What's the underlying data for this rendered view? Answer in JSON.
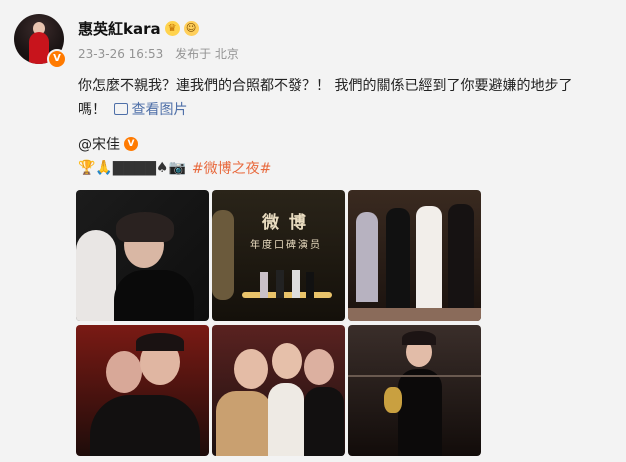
{
  "post": {
    "username": "惠英紅kara",
    "timestamp": "23-3-26 16:53",
    "posted_from": "发布于 北京",
    "text_line1": "你怎麼不親我？連我們的合照都不發？！ 我們的關係已經到了你要避嫌的地步了",
    "text_line2": "嗎！",
    "view_images_label": "查看图片",
    "mention": "@宋佳",
    "emoji_line": "🏆🙏▇▇▇▇♠📷",
    "hashtag": "#微博之夜#"
  },
  "images": {
    "tile2_title": "微 博",
    "tile2_subtitle": "年度口碑演员"
  },
  "colors": {
    "link_blue": "#4e6fa8",
    "hashtag_orange": "#e86a3e",
    "verified_orange": "#ff7a00",
    "meta_gray": "#939393"
  }
}
